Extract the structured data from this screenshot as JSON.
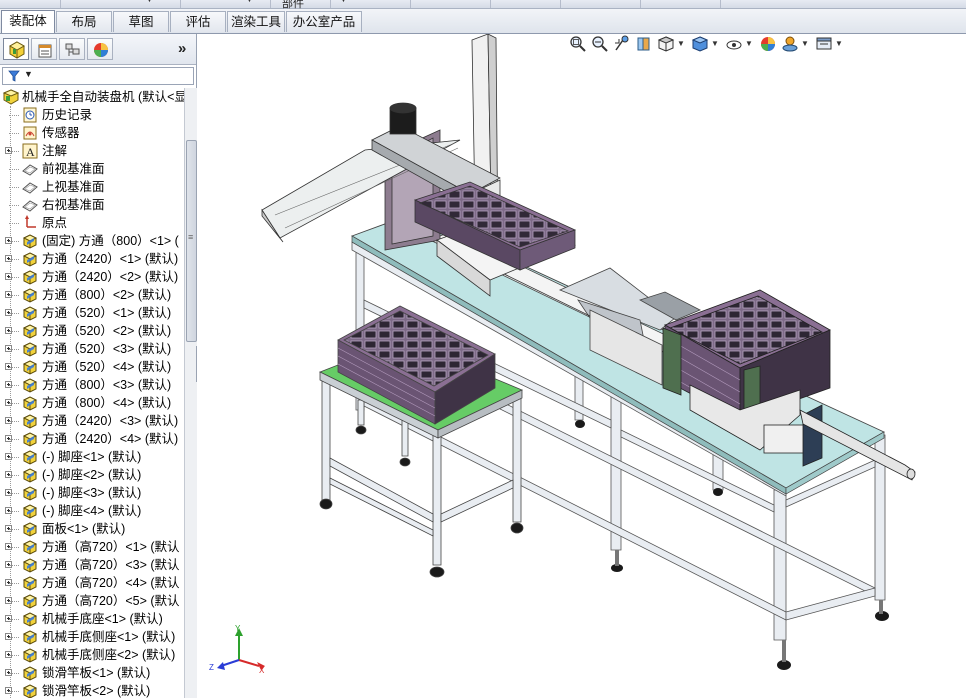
{
  "top_strip": {
    "visible_label": "部件"
  },
  "tabs": [
    {
      "label": "装配体",
      "active": true
    },
    {
      "label": "布局",
      "active": false
    },
    {
      "label": "草图",
      "active": false
    },
    {
      "label": "评估",
      "active": false
    },
    {
      "label": "渲染工具",
      "active": false
    },
    {
      "label": "办公室产品",
      "active": false
    }
  ],
  "panel": {
    "tabs": [
      "feature-manager-icon",
      "property-manager-icon",
      "configuration-manager-icon",
      "display-manager-icon"
    ],
    "more_glyph": "»",
    "filter_icon": "filter-icon"
  },
  "tree": {
    "root": "机械手全自动装盘机  (默认<显",
    "items": [
      {
        "label": "历史记录",
        "icon": "history"
      },
      {
        "label": "传感器",
        "icon": "sensor"
      },
      {
        "label": "注解",
        "icon": "annotation",
        "expandable": true
      },
      {
        "label": "前视基准面",
        "icon": "plane"
      },
      {
        "label": "上视基准面",
        "icon": "plane"
      },
      {
        "label": "右视基准面",
        "icon": "plane"
      },
      {
        "label": "原点",
        "icon": "origin"
      },
      {
        "label": "(固定) 方通（800）<1> (",
        "icon": "part",
        "expandable": true
      },
      {
        "label": "方通（2420）<1> (默认)",
        "icon": "part",
        "expandable": true
      },
      {
        "label": "方通（2420）<2> (默认)",
        "icon": "part",
        "expandable": true
      },
      {
        "label": "方通（800）<2> (默认)",
        "icon": "part",
        "expandable": true
      },
      {
        "label": "方通（520）<1> (默认)",
        "icon": "part",
        "expandable": true
      },
      {
        "label": "方通（520）<2> (默认)",
        "icon": "part",
        "expandable": true
      },
      {
        "label": "方通（520）<3> (默认)",
        "icon": "part",
        "expandable": true
      },
      {
        "label": "方通（520）<4> (默认)",
        "icon": "part",
        "expandable": true
      },
      {
        "label": "方通（800）<3> (默认)",
        "icon": "part",
        "expandable": true
      },
      {
        "label": "方通（800）<4> (默认)",
        "icon": "part",
        "expandable": true
      },
      {
        "label": "方通（2420）<3> (默认)",
        "icon": "part",
        "expandable": true
      },
      {
        "label": "方通（2420）<4> (默认)",
        "icon": "part",
        "expandable": true
      },
      {
        "label": "(-) 脚座<1> (默认)",
        "icon": "part",
        "expandable": true
      },
      {
        "label": "(-) 脚座<2> (默认)",
        "icon": "part",
        "expandable": true
      },
      {
        "label": "(-) 脚座<3> (默认)",
        "icon": "part",
        "expandable": true
      },
      {
        "label": "(-) 脚座<4> (默认)",
        "icon": "part",
        "expandable": true
      },
      {
        "label": "面板<1> (默认)",
        "icon": "part",
        "expandable": true
      },
      {
        "label": "方通（高720）<1> (默认",
        "icon": "part",
        "expandable": true
      },
      {
        "label": "方通（高720）<3> (默认",
        "icon": "part",
        "expandable": true
      },
      {
        "label": "方通（高720）<4> (默认",
        "icon": "part",
        "expandable": true
      },
      {
        "label": "方通（高720）<5> (默认",
        "icon": "part",
        "expandable": true
      },
      {
        "label": "机械手底座<1> (默认)",
        "icon": "part",
        "expandable": true
      },
      {
        "label": "机械手底侧座<1> (默认)",
        "icon": "part",
        "expandable": true
      },
      {
        "label": "机械手底侧座<2> (默认)",
        "icon": "part",
        "expandable": true
      },
      {
        "label": "锁滑竿板<1> (默认)",
        "icon": "part",
        "expandable": true
      },
      {
        "label": "锁滑竿板<2> (默认)",
        "icon": "part",
        "expandable": true
      }
    ]
  },
  "heads_up_toolbar": [
    "zoom-to-fit-icon",
    "zoom-to-area-icon",
    "previous-view-icon",
    "section-view-icon",
    "view-orientation-icon",
    "display-style-icon",
    "hide-show-items-icon",
    "edit-appearance-icon",
    "apply-scene-icon",
    "view-settings-icon"
  ],
  "triad": {
    "x": "X",
    "y": "Y",
    "z": "Z"
  },
  "colors": {
    "frame": "#e8ecf2",
    "table_top": "#bfe4e4",
    "green_top": "#66cc66",
    "tray": "#8a6f93",
    "tray_dark": "#463a4c"
  }
}
